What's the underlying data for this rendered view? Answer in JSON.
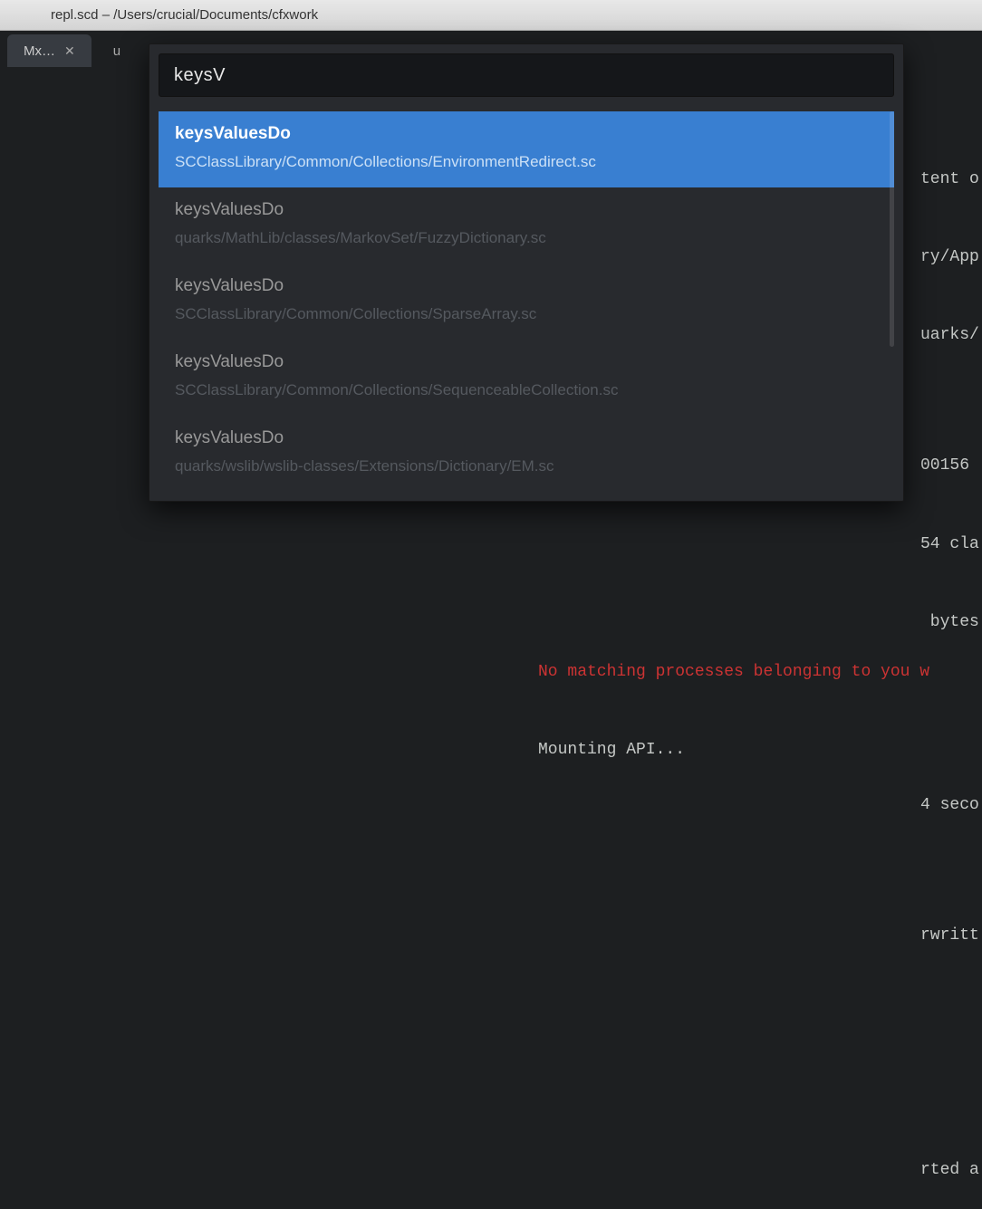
{
  "window": {
    "title": "repl.scd – /Users/crucial/Documents/cfxwork"
  },
  "tabs": [
    {
      "label": "Mx…",
      "close_glyph": "✕",
      "active": true
    },
    {
      "label": "u",
      "close_glyph": "",
      "active": false
    }
  ],
  "palette": {
    "query": "keysV",
    "results": [
      {
        "name": "keysValuesDo",
        "path": "SCClassLibrary/Common/Collections/EnvironmentRedirect.sc",
        "selected": true
      },
      {
        "name": "keysValuesDo",
        "path": "quarks/MathLib/classes/MarkovSet/FuzzyDictionary.sc",
        "selected": false
      },
      {
        "name": "keysValuesDo",
        "path": "SCClassLibrary/Common/Collections/SparseArray.sc",
        "selected": false
      },
      {
        "name": "keysValuesDo",
        "path": "SCClassLibrary/Common/Collections/SequenceableCollection.sc",
        "selected": false
      },
      {
        "name": "keysValuesDo",
        "path": "quarks/wslib/wslib-classes/Extensions/Dictionary/EM.sc",
        "selected": false
      }
    ]
  },
  "background_terminal": {
    "lines": [
      {
        "text": "tent o",
        "cls": ""
      },
      {
        "text": "ry/App",
        "cls": ""
      },
      {
        "text": "uarks/",
        "cls": ""
      },
      {
        "text": "",
        "cls": ""
      },
      {
        "text": "00156",
        "cls": ""
      },
      {
        "text": "54 cla",
        "cls": ""
      },
      {
        "text": " bytes",
        "cls": ""
      },
      {
        "text": "",
        "cls": ""
      },
      {
        "text": "",
        "cls": ""
      },
      {
        "text": "4 seco",
        "cls": ""
      },
      {
        "text": "",
        "cls": ""
      },
      {
        "text": "rwritt",
        "cls": ""
      },
      {
        "text": "",
        "cls": ""
      },
      {
        "text": "",
        "cls": ""
      },
      {
        "text": "",
        "cls": ""
      },
      {
        "text": "rted a",
        "cls": ""
      }
    ],
    "bottom_lines": [
      {
        "text": "No matching processes belonging to you w",
        "cls": "red"
      },
      {
        "text": "Mounting API...",
        "cls": ""
      }
    ]
  }
}
